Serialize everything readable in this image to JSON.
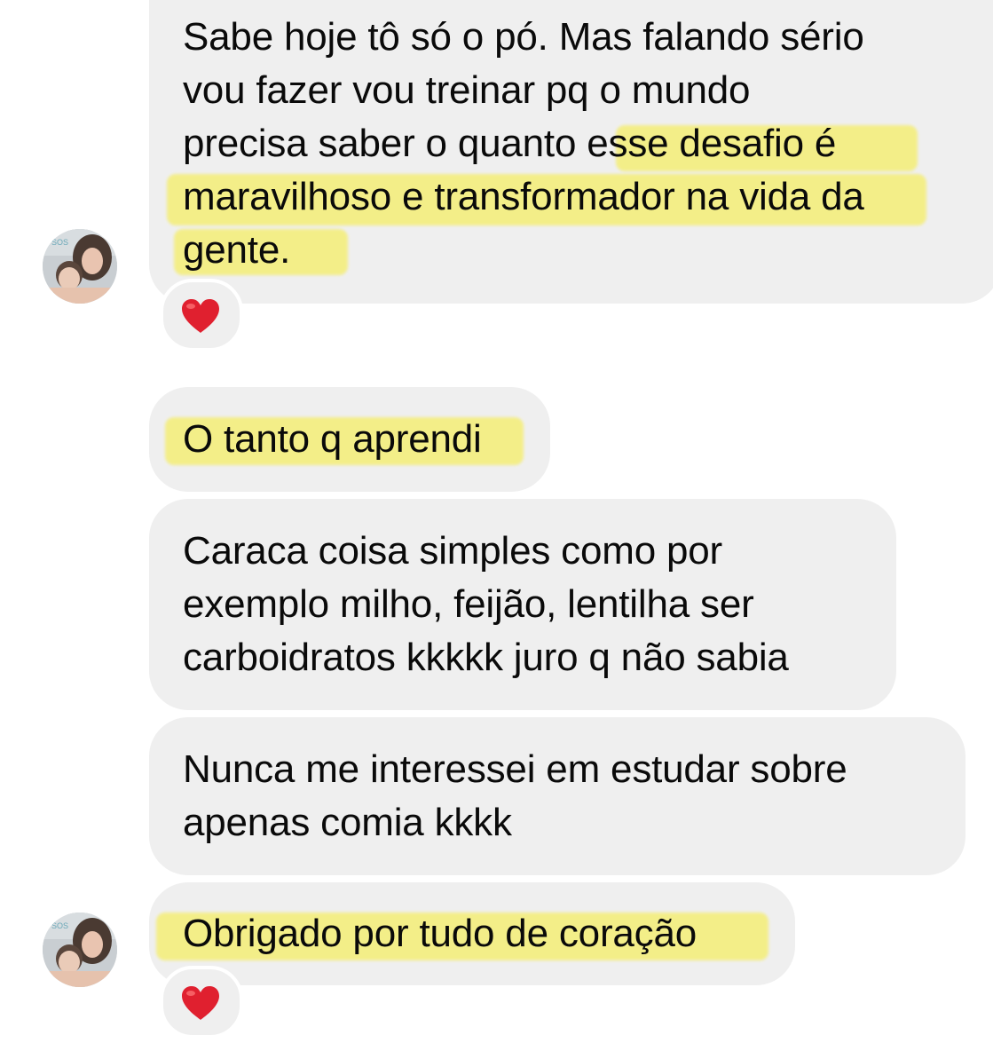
{
  "messages": [
    {
      "lines": [
        "Sabe hoje tô só o pó. Mas falando sério",
        "vou fazer vou treinar pq o mundo",
        "precisa saber o quanto esse desafio é",
        "maravilhoso e transformador na vida da",
        "gente."
      ],
      "reaction": "red-heart"
    },
    {
      "lines": [
        "O tanto q aprendi"
      ]
    },
    {
      "lines": [
        "Caraca coisa simples como por",
        "exemplo milho, feijão, lentilha ser",
        "carboidratos kkkkk juro q não sabia"
      ]
    },
    {
      "lines": [
        "Nunca me interessei em estudar sobre",
        "apenas comia kkkk"
      ]
    },
    {
      "lines": [
        "Obrigado por tudo de coração"
      ],
      "reaction": "red-heart"
    }
  ],
  "colors": {
    "bubble": "#efefef",
    "highlight": "#f4ee83",
    "text": "#0a0a0a",
    "heart": "#e0202f"
  }
}
